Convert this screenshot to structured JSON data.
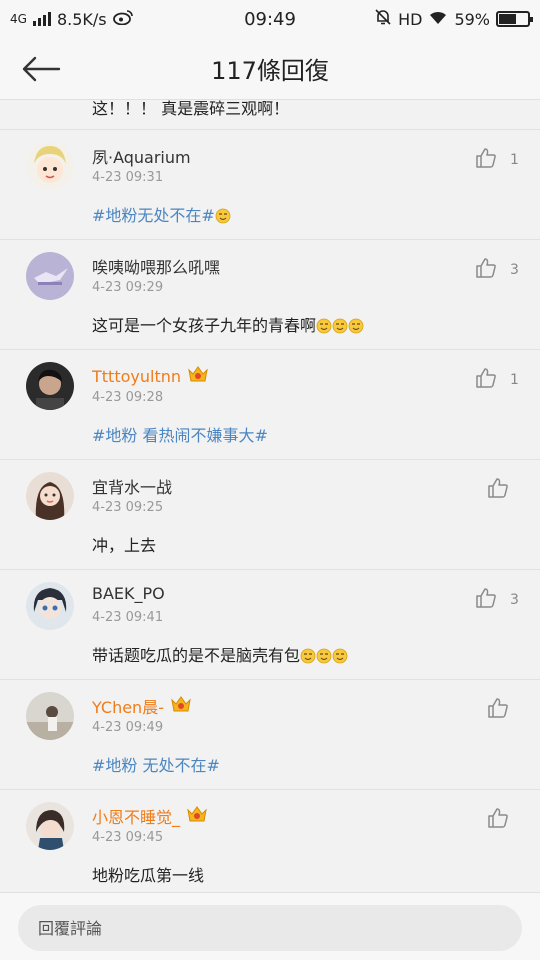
{
  "status_bar": {
    "network_type": "4G",
    "speed": "8.5K/s",
    "time": "09:49",
    "hd": "HD",
    "battery_percent": "59%",
    "battery_level": 0.59
  },
  "header": {
    "title": "117條回復"
  },
  "partial_comment": {
    "text": "这！！！ 真是震碎三观啊！"
  },
  "comments": [
    {
      "user": "夙·Aquarium",
      "time": "4-23 09:31",
      "topic": "#地粉无处不在#",
      "text": "",
      "emoji_count": 1,
      "likes": "1",
      "vip": false
    },
    {
      "user": "唉咦呦喂那么吼嘿",
      "time": "4-23 09:29",
      "topic": "",
      "text": "这可是一个女孩子九年的青春啊",
      "emoji_count": 3,
      "likes": "3",
      "vip": false
    },
    {
      "user": "Ttttoyultnn",
      "time": "4-23 09:28",
      "topic": "#地粉 看热闹不嫌事大#",
      "text": "",
      "emoji_count": 0,
      "likes": "1",
      "vip": true
    },
    {
      "user": "宜背水一战",
      "time": "4-23 09:25",
      "topic": "",
      "text": "冲，上去",
      "emoji_count": 0,
      "likes": "",
      "vip": false
    },
    {
      "user": "BAEK_PO",
      "time": "4-23 09:41",
      "topic": "",
      "text": "带话题吃瓜的是不是脑壳有包",
      "emoji_count": 3,
      "likes": "3",
      "vip": false
    },
    {
      "user": "YChen晨-",
      "time": "4-23 09:49",
      "topic": "#地粉 无处不在#",
      "text": "",
      "emoji_count": 0,
      "likes": "",
      "vip": true
    },
    {
      "user": "小恩不睡觉_",
      "time": "4-23 09:45",
      "topic": "",
      "text": "地粉吃瓜第一线",
      "emoji_count": 0,
      "likes": "",
      "vip": true
    }
  ],
  "reply_bar": {
    "placeholder": "回覆評論"
  },
  "colors": {
    "topic": "#4b86c2",
    "vip_name": "#f07c1a",
    "background": "#f2f2f2"
  }
}
